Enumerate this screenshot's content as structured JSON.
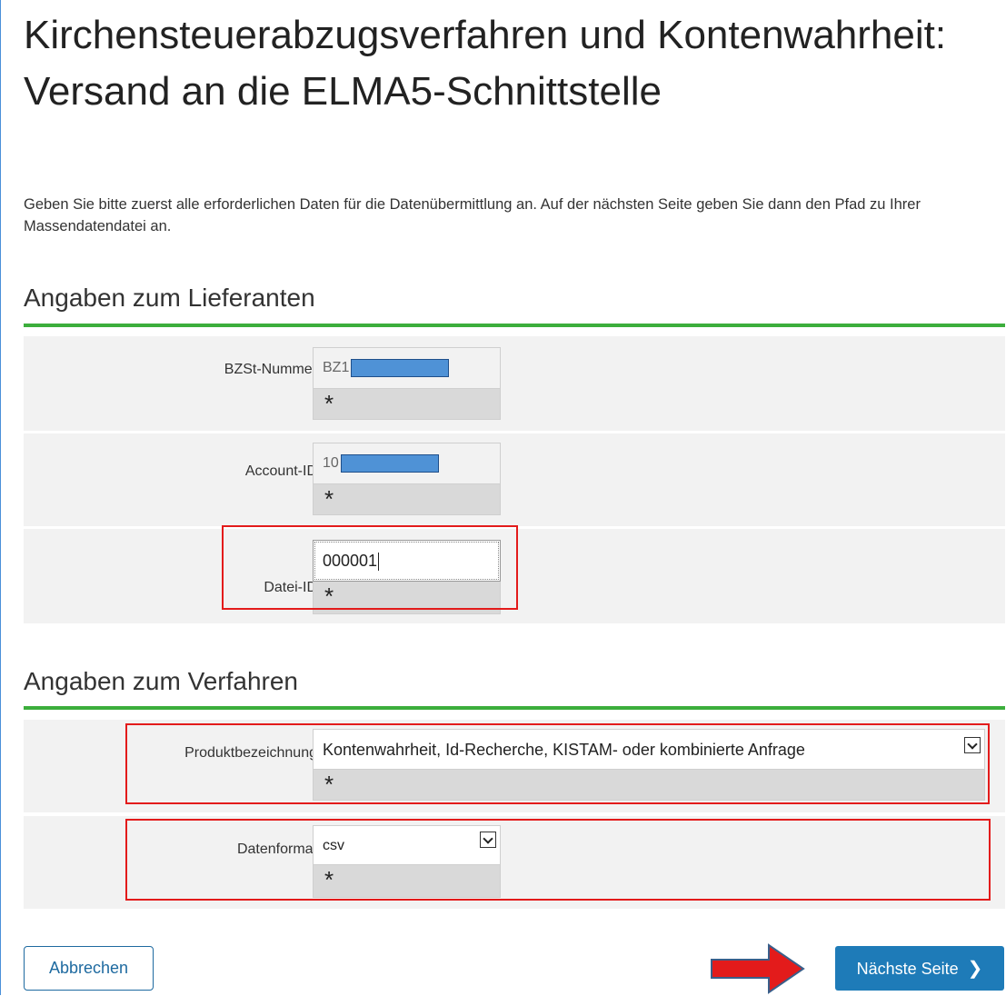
{
  "page": {
    "title": "Kirchensteuerabzugsverfahren und Kontenwahrheit: Versand an die ELMA5-Schnittstelle",
    "intro": "Geben Sie bitte zuerst alle erforderlichen Daten für die Datenübermittlung an. Auf der nächsten Seite geben Sie dann den Pfad zu Ihrer Massendatendatei an."
  },
  "supplier": {
    "heading": "Angaben zum Lieferanten",
    "bzst": {
      "label": "BZSt-Nummer",
      "value": "BZ1",
      "required": "*"
    },
    "account": {
      "label": "Account-ID",
      "value": "10",
      "required": "*"
    },
    "file": {
      "label": "Datei-ID",
      "value": "000001",
      "required": "*"
    }
  },
  "procedure": {
    "heading": "Angaben zum Verfahren",
    "product": {
      "label": "Produktbezeichnung",
      "value": "Kontenwahrheit, Id-Recherche, KISTAM- oder kombinierte Anfrage",
      "required": "*"
    },
    "format": {
      "label": "Datenformat",
      "value": "csv",
      "required": "*"
    }
  },
  "buttons": {
    "cancel": "Abbrechen",
    "next": "Nächste Seite",
    "next_chevron": "❯"
  },
  "colors": {
    "accent": "#1e7bb8",
    "section_rule": "#3cae3c",
    "highlight": "#e31b1b",
    "arrow": "#e31b1b"
  }
}
